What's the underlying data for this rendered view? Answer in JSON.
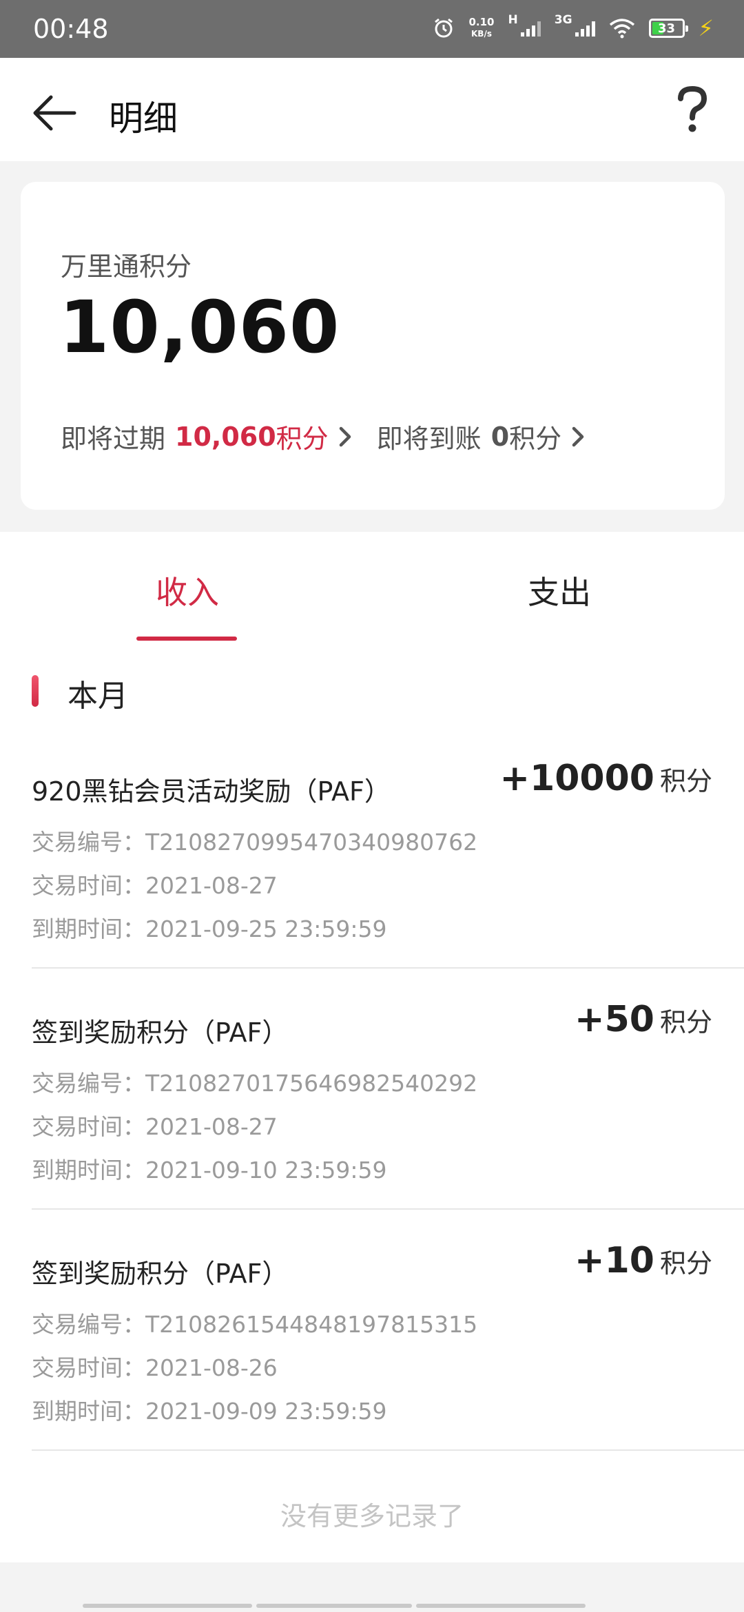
{
  "status_bar": {
    "time": "00:48",
    "net_speed_value": "0.10",
    "net_speed_unit": "KB/s",
    "signal_1_label": "H",
    "signal_2_label": "3G",
    "battery_level": "33"
  },
  "header": {
    "title": "明细"
  },
  "summary": {
    "label": "万里通积分",
    "points": "10,060",
    "expiring_label": "即将过期",
    "expiring_value": "10,060",
    "expiring_unit": "积分",
    "incoming_label": "即将到账",
    "incoming_value": "0",
    "incoming_unit": "积分"
  },
  "tabs": [
    {
      "label": "收入",
      "active": true
    },
    {
      "label": "支出",
      "active": false
    }
  ],
  "section": {
    "title": "本月"
  },
  "records": [
    {
      "title": "920黑钻会员活动奖励（PAF）",
      "amount": "+10000",
      "unit": "积分",
      "tx_no": "交易编号：T2108270995470340980762",
      "tx_time": "交易时间：2021-08-27",
      "expire_time": "到期时间：2021-09-25 23:59:59"
    },
    {
      "title": "签到奖励积分（PAF）",
      "amount": "+50",
      "unit": "积分",
      "tx_no": "交易编号：T2108270175646982540292",
      "tx_time": "交易时间：2021-08-27",
      "expire_time": "到期时间：2021-09-10 23:59:59"
    },
    {
      "title": "签到奖励积分（PAF）",
      "amount": "+10",
      "unit": "积分",
      "tx_no": "交易编号：T2108261544848197815315",
      "tx_time": "交易时间：2021-08-26",
      "expire_time": "到期时间：2021-09-09 23:59:59"
    }
  ],
  "footer": {
    "no_more_text": "没有更多记录了"
  },
  "colors": {
    "accent": "#d12a45",
    "status_bar": "#6e6e6e"
  }
}
